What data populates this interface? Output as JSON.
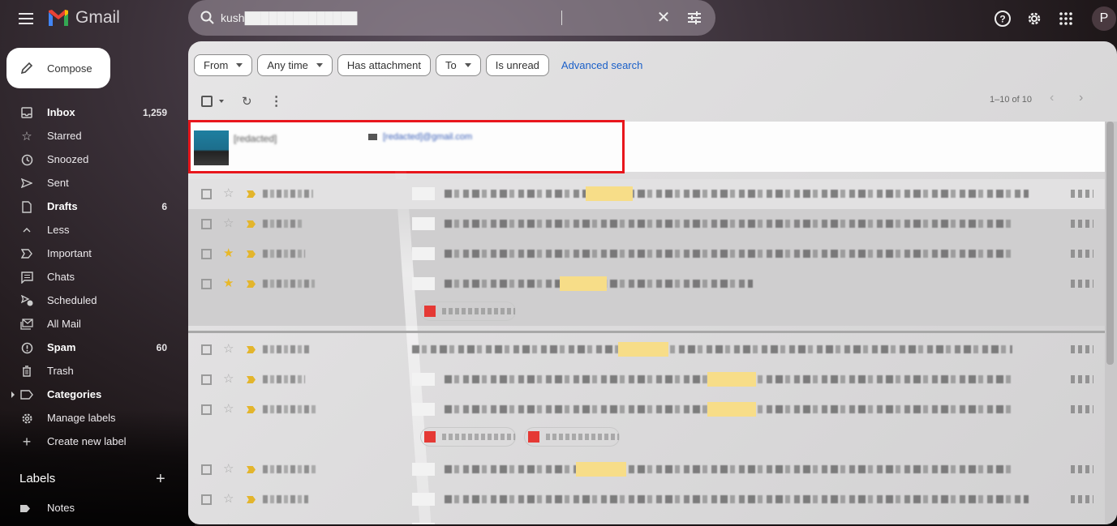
{
  "app": {
    "name": "Gmail",
    "accent": "#1a5fc8",
    "highlight": "#e8161c"
  },
  "header": {
    "search_value": "kush██████████████",
    "clear_icon": "close-icon",
    "options_icon": "tune-icon",
    "help_icon": "help-icon",
    "settings_icon": "gear-icon",
    "apps_icon": "apps-grid-icon",
    "avatar_initial": "P"
  },
  "compose": {
    "label": "Compose"
  },
  "sidebar": {
    "items": [
      {
        "label": "Inbox",
        "count": "1,259",
        "bold": true,
        "icon": "inbox-icon"
      },
      {
        "label": "Starred",
        "count": "",
        "bold": false,
        "icon": "star-icon"
      },
      {
        "label": "Snoozed",
        "count": "",
        "bold": false,
        "icon": "clock-icon"
      },
      {
        "label": "Sent",
        "count": "",
        "bold": false,
        "icon": "send-icon"
      },
      {
        "label": "Drafts",
        "count": "6",
        "bold": true,
        "icon": "draft-icon"
      },
      {
        "label": "Less",
        "count": "",
        "bold": false,
        "icon": "chevron-up-icon"
      },
      {
        "label": "Important",
        "count": "",
        "bold": false,
        "icon": "important-icon"
      },
      {
        "label": "Chats",
        "count": "",
        "bold": false,
        "icon": "chat-icon"
      },
      {
        "label": "Scheduled",
        "count": "",
        "bold": false,
        "icon": "scheduled-icon"
      },
      {
        "label": "All Mail",
        "count": "",
        "bold": false,
        "icon": "all-mail-icon"
      },
      {
        "label": "Spam",
        "count": "60",
        "bold": true,
        "icon": "spam-icon"
      },
      {
        "label": "Trash",
        "count": "",
        "bold": false,
        "icon": "trash-icon"
      },
      {
        "label": "Categories",
        "count": "",
        "bold": true,
        "icon": "label-icon"
      },
      {
        "label": "Manage labels",
        "count": "",
        "bold": false,
        "icon": "gear-icon"
      },
      {
        "label": "Create new label",
        "count": "",
        "bold": false,
        "icon": "plus-icon"
      }
    ],
    "labels_heading": "Labels",
    "labels": [
      {
        "label": "Notes"
      }
    ]
  },
  "filters": {
    "chips": [
      {
        "label": "From",
        "dropdown": true
      },
      {
        "label": "Any time",
        "dropdown": true
      },
      {
        "label": "Has attachment",
        "dropdown": false
      },
      {
        "label": "To",
        "dropdown": true
      },
      {
        "label": "Is unread",
        "dropdown": false
      }
    ],
    "advanced_search": "Advanced search"
  },
  "toolbar": {
    "refresh_glyph": "↻",
    "more_glyph": "⋮"
  },
  "paging": {
    "range": "1–10 of 10",
    "prev": "‹",
    "next": "›"
  },
  "contact_card": {
    "name": "[redacted]",
    "email": "[redacted]@gmail.com"
  },
  "emails": [
    {
      "starred": false,
      "redacted": true,
      "highlight": true,
      "attachments": 0
    },
    {
      "starred": false,
      "redacted": true,
      "highlight": false,
      "attachments": 0
    },
    {
      "starred": true,
      "redacted": true,
      "highlight": false,
      "attachments": 0
    },
    {
      "starred": true,
      "redacted": true,
      "highlight": true,
      "attachments": 1
    },
    {
      "starred": false,
      "redacted": true,
      "highlight": true,
      "attachments": 0
    },
    {
      "starred": false,
      "redacted": true,
      "highlight": true,
      "attachments": 0
    },
    {
      "starred": false,
      "redacted": true,
      "highlight": true,
      "attachments": 2
    },
    {
      "starred": false,
      "redacted": true,
      "highlight": true,
      "attachments": 0
    },
    {
      "starred": false,
      "redacted": true,
      "highlight": false,
      "attachments": 0
    },
    {
      "starred": false,
      "redacted": true,
      "highlight": false,
      "attachments": 0
    }
  ]
}
